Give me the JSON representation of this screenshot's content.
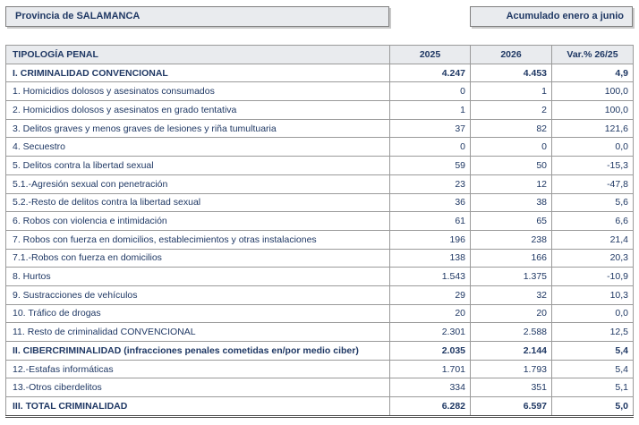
{
  "header": {
    "province": "Provincia de SALAMANCA",
    "period": "Acumulado enero a junio"
  },
  "table": {
    "columns": [
      "TIPOLOGÍA PENAL",
      "2025",
      "2026",
      "Var.% 26/25"
    ],
    "rows": [
      {
        "label": "I. CRIMINALIDAD CONVENCIONAL",
        "v2025": "4.247",
        "v2026": "4.453",
        "var": "4,9",
        "kind": "section"
      },
      {
        "label": "1. Homicidios dolosos y asesinatos consumados",
        "v2025": "0",
        "v2026": "1",
        "var": "100,0",
        "kind": "item"
      },
      {
        "label": "2. Homicidios dolosos y asesinatos en grado tentativa",
        "v2025": "1",
        "v2026": "2",
        "var": "100,0",
        "kind": "item"
      },
      {
        "label": "3. Delitos graves y menos graves de lesiones y riña tumultuaria",
        "v2025": "37",
        "v2026": "82",
        "var": "121,6",
        "kind": "item"
      },
      {
        "label": "4. Secuestro",
        "v2025": "0",
        "v2026": "0",
        "var": "0,0",
        "kind": "item"
      },
      {
        "label": "5. Delitos contra la libertad sexual",
        "v2025": "59",
        "v2026": "50",
        "var": "-15,3",
        "kind": "item"
      },
      {
        "label": "5.1.-Agresión sexual con penetración",
        "v2025": "23",
        "v2026": "12",
        "var": "-47,8",
        "kind": "item"
      },
      {
        "label": "5.2.-Resto de delitos contra la libertad sexual",
        "v2025": "36",
        "v2026": "38",
        "var": "5,6",
        "kind": "item"
      },
      {
        "label": "6. Robos con violencia e intimidación",
        "v2025": "61",
        "v2026": "65",
        "var": "6,6",
        "kind": "item"
      },
      {
        "label": "7. Robos con fuerza en domicilios, establecimientos y otras instalaciones",
        "v2025": "196",
        "v2026": "238",
        "var": "21,4",
        "kind": "item"
      },
      {
        "label": "7.1.-Robos con fuerza en domicilios",
        "v2025": "138",
        "v2026": "166",
        "var": "20,3",
        "kind": "item"
      },
      {
        "label": "8. Hurtos",
        "v2025": "1.543",
        "v2026": "1.375",
        "var": "-10,9",
        "kind": "item"
      },
      {
        "label": "9. Sustracciones de vehículos",
        "v2025": "29",
        "v2026": "32",
        "var": "10,3",
        "kind": "item"
      },
      {
        "label": "10. Tráfico de drogas",
        "v2025": "20",
        "v2026": "20",
        "var": "0,0",
        "kind": "item"
      },
      {
        "label": "11. Resto de criminalidad CONVENCIONAL",
        "v2025": "2.301",
        "v2026": "2.588",
        "var": "12,5",
        "kind": "item"
      },
      {
        "label": "II. CIBERCRIMINALIDAD (infracciones penales cometidas en/por medio ciber)",
        "v2025": "2.035",
        "v2026": "2.144",
        "var": "5,4",
        "kind": "section"
      },
      {
        "label": "12.-Estafas informáticas",
        "v2025": "1.701",
        "v2026": "1.793",
        "var": "5,4",
        "kind": "item"
      },
      {
        "label": "13.-Otros ciberdelitos",
        "v2025": "334",
        "v2026": "351",
        "var": "5,1",
        "kind": "item"
      },
      {
        "label": "III. TOTAL CRIMINALIDAD",
        "v2025": "6.282",
        "v2026": "6.597",
        "var": "5,0",
        "kind": "total"
      }
    ]
  }
}
